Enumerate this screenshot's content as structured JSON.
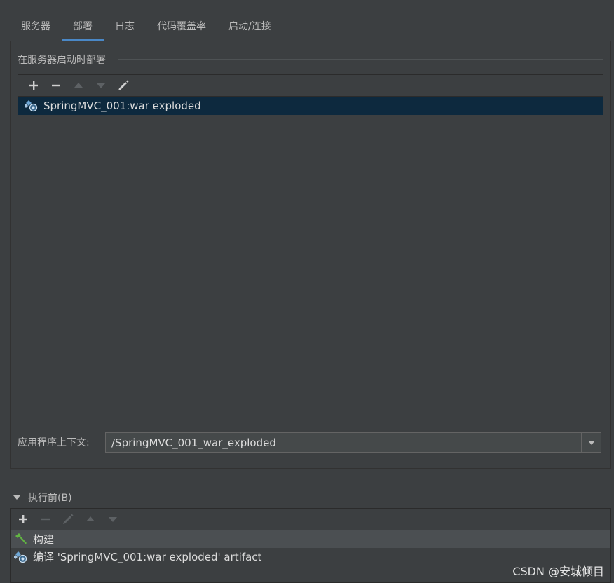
{
  "tabs": [
    {
      "label": "服务器",
      "active": false
    },
    {
      "label": "部署",
      "active": true
    },
    {
      "label": "日志",
      "active": false
    },
    {
      "label": "代码覆盖率",
      "active": false
    },
    {
      "label": "启动/连接",
      "active": false
    }
  ],
  "deploy": {
    "section_title": "在服务器启动时部署",
    "toolbar_icons": [
      "plus-icon",
      "minus-icon",
      "arrow-up-icon",
      "arrow-down-icon",
      "pencil-icon"
    ],
    "items": [
      {
        "label": "SpringMVC_001:war exploded",
        "icon": "artifact-icon",
        "selected": true
      }
    ]
  },
  "context": {
    "label": "应用程序上下文:",
    "value": "/SpringMVC_001_war_exploded"
  },
  "before_launch": {
    "title": "执行前(B)",
    "toolbar_icons": [
      "plus-icon",
      "minus-icon",
      "pencil-icon",
      "arrow-up-icon",
      "arrow-down-icon"
    ],
    "items": [
      {
        "label": "构建",
        "icon": "hammer-icon"
      },
      {
        "label": "编译 'SpringMVC_001:war exploded' artifact",
        "icon": "artifact-icon"
      }
    ]
  },
  "watermark": "CSDN @安城倾目",
  "colors": {
    "background": "#3c3f41",
    "selection": "#0d293e",
    "accent": "#4a88c7",
    "hammer_green": "#62b543"
  }
}
